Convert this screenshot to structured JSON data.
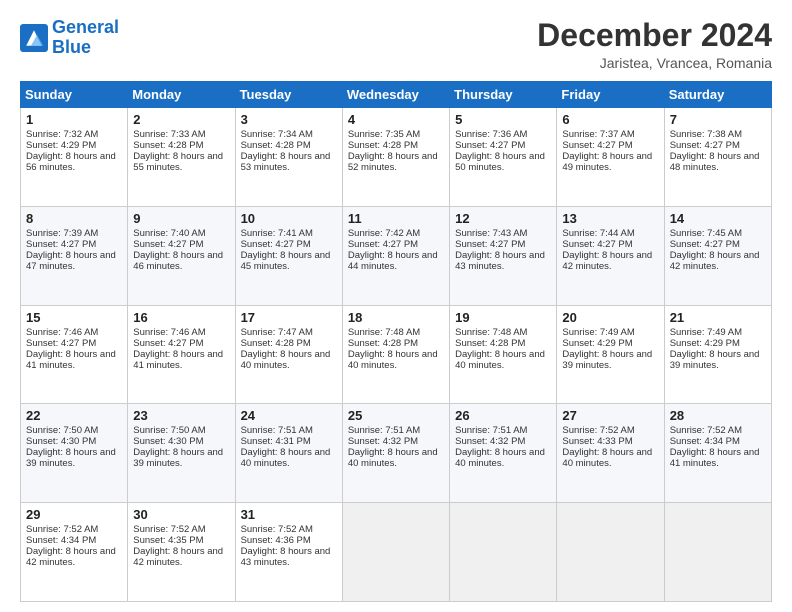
{
  "logo": {
    "line1": "General",
    "line2": "Blue"
  },
  "title": "December 2024",
  "location": "Jaristea, Vrancea, Romania",
  "days_header": [
    "Sunday",
    "Monday",
    "Tuesday",
    "Wednesday",
    "Thursday",
    "Friday",
    "Saturday"
  ],
  "weeks": [
    [
      {
        "day": "1",
        "sunrise": "7:32 AM",
        "sunset": "4:29 PM",
        "daylight": "8 hours and 56 minutes."
      },
      {
        "day": "2",
        "sunrise": "7:33 AM",
        "sunset": "4:28 PM",
        "daylight": "8 hours and 55 minutes."
      },
      {
        "day": "3",
        "sunrise": "7:34 AM",
        "sunset": "4:28 PM",
        "daylight": "8 hours and 53 minutes."
      },
      {
        "day": "4",
        "sunrise": "7:35 AM",
        "sunset": "4:28 PM",
        "daylight": "8 hours and 52 minutes."
      },
      {
        "day": "5",
        "sunrise": "7:36 AM",
        "sunset": "4:27 PM",
        "daylight": "8 hours and 50 minutes."
      },
      {
        "day": "6",
        "sunrise": "7:37 AM",
        "sunset": "4:27 PM",
        "daylight": "8 hours and 49 minutes."
      },
      {
        "day": "7",
        "sunrise": "7:38 AM",
        "sunset": "4:27 PM",
        "daylight": "8 hours and 48 minutes."
      }
    ],
    [
      {
        "day": "8",
        "sunrise": "7:39 AM",
        "sunset": "4:27 PM",
        "daylight": "8 hours and 47 minutes."
      },
      {
        "day": "9",
        "sunrise": "7:40 AM",
        "sunset": "4:27 PM",
        "daylight": "8 hours and 46 minutes."
      },
      {
        "day": "10",
        "sunrise": "7:41 AM",
        "sunset": "4:27 PM",
        "daylight": "8 hours and 45 minutes."
      },
      {
        "day": "11",
        "sunrise": "7:42 AM",
        "sunset": "4:27 PM",
        "daylight": "8 hours and 44 minutes."
      },
      {
        "day": "12",
        "sunrise": "7:43 AM",
        "sunset": "4:27 PM",
        "daylight": "8 hours and 43 minutes."
      },
      {
        "day": "13",
        "sunrise": "7:44 AM",
        "sunset": "4:27 PM",
        "daylight": "8 hours and 42 minutes."
      },
      {
        "day": "14",
        "sunrise": "7:45 AM",
        "sunset": "4:27 PM",
        "daylight": "8 hours and 42 minutes."
      }
    ],
    [
      {
        "day": "15",
        "sunrise": "7:46 AM",
        "sunset": "4:27 PM",
        "daylight": "8 hours and 41 minutes."
      },
      {
        "day": "16",
        "sunrise": "7:46 AM",
        "sunset": "4:27 PM",
        "daylight": "8 hours and 41 minutes."
      },
      {
        "day": "17",
        "sunrise": "7:47 AM",
        "sunset": "4:28 PM",
        "daylight": "8 hours and 40 minutes."
      },
      {
        "day": "18",
        "sunrise": "7:48 AM",
        "sunset": "4:28 PM",
        "daylight": "8 hours and 40 minutes."
      },
      {
        "day": "19",
        "sunrise": "7:48 AM",
        "sunset": "4:28 PM",
        "daylight": "8 hours and 40 minutes."
      },
      {
        "day": "20",
        "sunrise": "7:49 AM",
        "sunset": "4:29 PM",
        "daylight": "8 hours and 39 minutes."
      },
      {
        "day": "21",
        "sunrise": "7:49 AM",
        "sunset": "4:29 PM",
        "daylight": "8 hours and 39 minutes."
      }
    ],
    [
      {
        "day": "22",
        "sunrise": "7:50 AM",
        "sunset": "4:30 PM",
        "daylight": "8 hours and 39 minutes."
      },
      {
        "day": "23",
        "sunrise": "7:50 AM",
        "sunset": "4:30 PM",
        "daylight": "8 hours and 39 minutes."
      },
      {
        "day": "24",
        "sunrise": "7:51 AM",
        "sunset": "4:31 PM",
        "daylight": "8 hours and 40 minutes."
      },
      {
        "day": "25",
        "sunrise": "7:51 AM",
        "sunset": "4:32 PM",
        "daylight": "8 hours and 40 minutes."
      },
      {
        "day": "26",
        "sunrise": "7:51 AM",
        "sunset": "4:32 PM",
        "daylight": "8 hours and 40 minutes."
      },
      {
        "day": "27",
        "sunrise": "7:52 AM",
        "sunset": "4:33 PM",
        "daylight": "8 hours and 40 minutes."
      },
      {
        "day": "28",
        "sunrise": "7:52 AM",
        "sunset": "4:34 PM",
        "daylight": "8 hours and 41 minutes."
      }
    ],
    [
      {
        "day": "29",
        "sunrise": "7:52 AM",
        "sunset": "4:34 PM",
        "daylight": "8 hours and 42 minutes."
      },
      {
        "day": "30",
        "sunrise": "7:52 AM",
        "sunset": "4:35 PM",
        "daylight": "8 hours and 42 minutes."
      },
      {
        "day": "31",
        "sunrise": "7:52 AM",
        "sunset": "4:36 PM",
        "daylight": "8 hours and 43 minutes."
      },
      null,
      null,
      null,
      null
    ]
  ]
}
